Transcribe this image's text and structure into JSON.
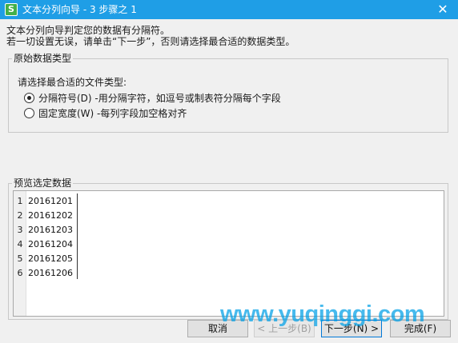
{
  "window": {
    "title": "文本分列向导 - 3 步骤之 1",
    "app_icon": "S",
    "icon": "wps-spreadsheet-icon",
    "close_glyph": "✕",
    "title_bar_color": "#1f9ee6"
  },
  "intro": {
    "line1": "文本分列向导判定您的数据有分隔符。",
    "line2": "若一切设置无误，请单击“下一步”，否则请选择最合适的数据类型。"
  },
  "original_type": {
    "legend": "原始数据类型",
    "prompt": "请选择最合适的文件类型:",
    "options": [
      {
        "label": "分隔符号(D)  -用分隔字符，如逗号或制表符分隔每个字段",
        "checked": true
      },
      {
        "label": "固定宽度(W)  -每列字段加空格对齐",
        "checked": false
      }
    ]
  },
  "preview": {
    "legend": "预览选定数据",
    "rows": [
      {
        "num": "1",
        "value": "20161201"
      },
      {
        "num": "2",
        "value": "20161202"
      },
      {
        "num": "3",
        "value": "20161203"
      },
      {
        "num": "4",
        "value": "20161204"
      },
      {
        "num": "5",
        "value": "20161205"
      },
      {
        "num": "6",
        "value": "20161206"
      }
    ]
  },
  "buttons": {
    "cancel": "取消",
    "back": "< 上一步(B)",
    "next": "下一步(N) >",
    "finish": "完成(F)"
  },
  "watermark": "www.yuqinggi.com"
}
